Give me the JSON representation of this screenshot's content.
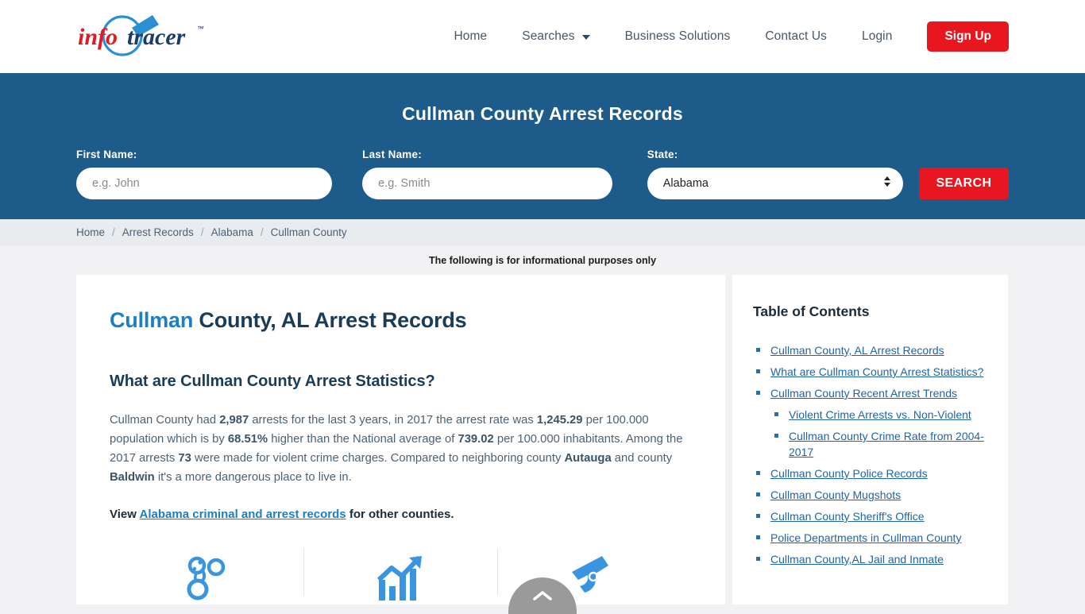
{
  "header": {
    "logo": {
      "part1": "info",
      "part2": "tracer",
      "tm": "™",
      "icon": "magnifier-icon"
    },
    "nav": [
      {
        "label": "Home",
        "name": "nav-home"
      },
      {
        "label": "Searches",
        "name": "nav-searches",
        "has_chevron": true
      },
      {
        "label": "Business Solutions",
        "name": "nav-business-solutions"
      },
      {
        "label": "Contact Us",
        "name": "nav-contact-us"
      },
      {
        "label": "Login",
        "name": "nav-login"
      }
    ],
    "signup_label": "Sign Up"
  },
  "banner": {
    "title": "Cullman County Arrest Records",
    "first_name_label": "First Name:",
    "first_name_placeholder": "e.g. John",
    "first_name_value": "",
    "last_name_label": "Last Name:",
    "last_name_placeholder": "e.g. Smith",
    "last_name_value": "",
    "state_label": "State:",
    "state_value": "Alabama",
    "search_label": "SEARCH",
    "bg_color": "#1d5b8a",
    "button_color": "#e8161f"
  },
  "breadcrumb": [
    {
      "label": "Home"
    },
    {
      "label": "Arrest Records"
    },
    {
      "label": "Alabama"
    },
    {
      "label": "Cullman County"
    }
  ],
  "breadcrumb_separator": "/",
  "notice": "The following is for informational purposes only",
  "main": {
    "title_highlight": "Cullman",
    "title_rest": " County, AL Arrest Records",
    "subtitle": "What are Cullman County Arrest Statistics?",
    "paragraph": {
      "p1": "Cullman County had ",
      "b1": "2,987",
      "p2": " arrests for the last 3 years, in 2017 the arrest rate was ",
      "b2": "1,245.29",
      "p3": " per 100.000 population which is by ",
      "b3": "68.51%",
      "p4": " higher than the National average of ",
      "b4": "739.02",
      "p5": " per 100.000 inhabitants. Among the 2017 arrests ",
      "b5": "73",
      "p6": " were made for violent crime charges. Compared to neighboring county ",
      "b6": "Autauga",
      "p7": " and county ",
      "b7": "Baldwin",
      "p8": " it's a more dangerous place to live in."
    },
    "view_line": {
      "prefix": "View ",
      "link": "Alabama criminal and arrest records",
      "suffix": " for other counties."
    },
    "icons": [
      {
        "name": "handcuffs-icon"
      },
      {
        "name": "arrest-trend-chart-icon"
      },
      {
        "name": "gun-icon"
      }
    ],
    "accent_color": "#1a7fc4"
  },
  "sidebar": {
    "toc_title": "Table of Contents",
    "items": [
      {
        "label": "Cullman County, AL Arrest Records",
        "level": 1
      },
      {
        "label": "What are Cullman County Arrest Statistics?",
        "level": 1
      },
      {
        "label": "Cullman County Recent Arrest Trends",
        "level": 1
      },
      {
        "label": "Violent Crime Arrests vs. Non-Violent",
        "level": 2
      },
      {
        "label": "Cullman County Crime Rate from 2004-2017",
        "level": 2
      },
      {
        "label": "Cullman County Police Records",
        "level": 1
      },
      {
        "label": "Cullman County Mugshots",
        "level": 1
      },
      {
        "label": "Cullman County Sheriff's Office",
        "level": 1
      },
      {
        "label": "Police Departments in Cullman County",
        "level": 1
      },
      {
        "label": "Cullman County,AL Jail and Inmate",
        "level": 1
      }
    ]
  },
  "scroll_top": {
    "name": "scroll-to-top-button",
    "icon": "chevron-up-icon"
  }
}
